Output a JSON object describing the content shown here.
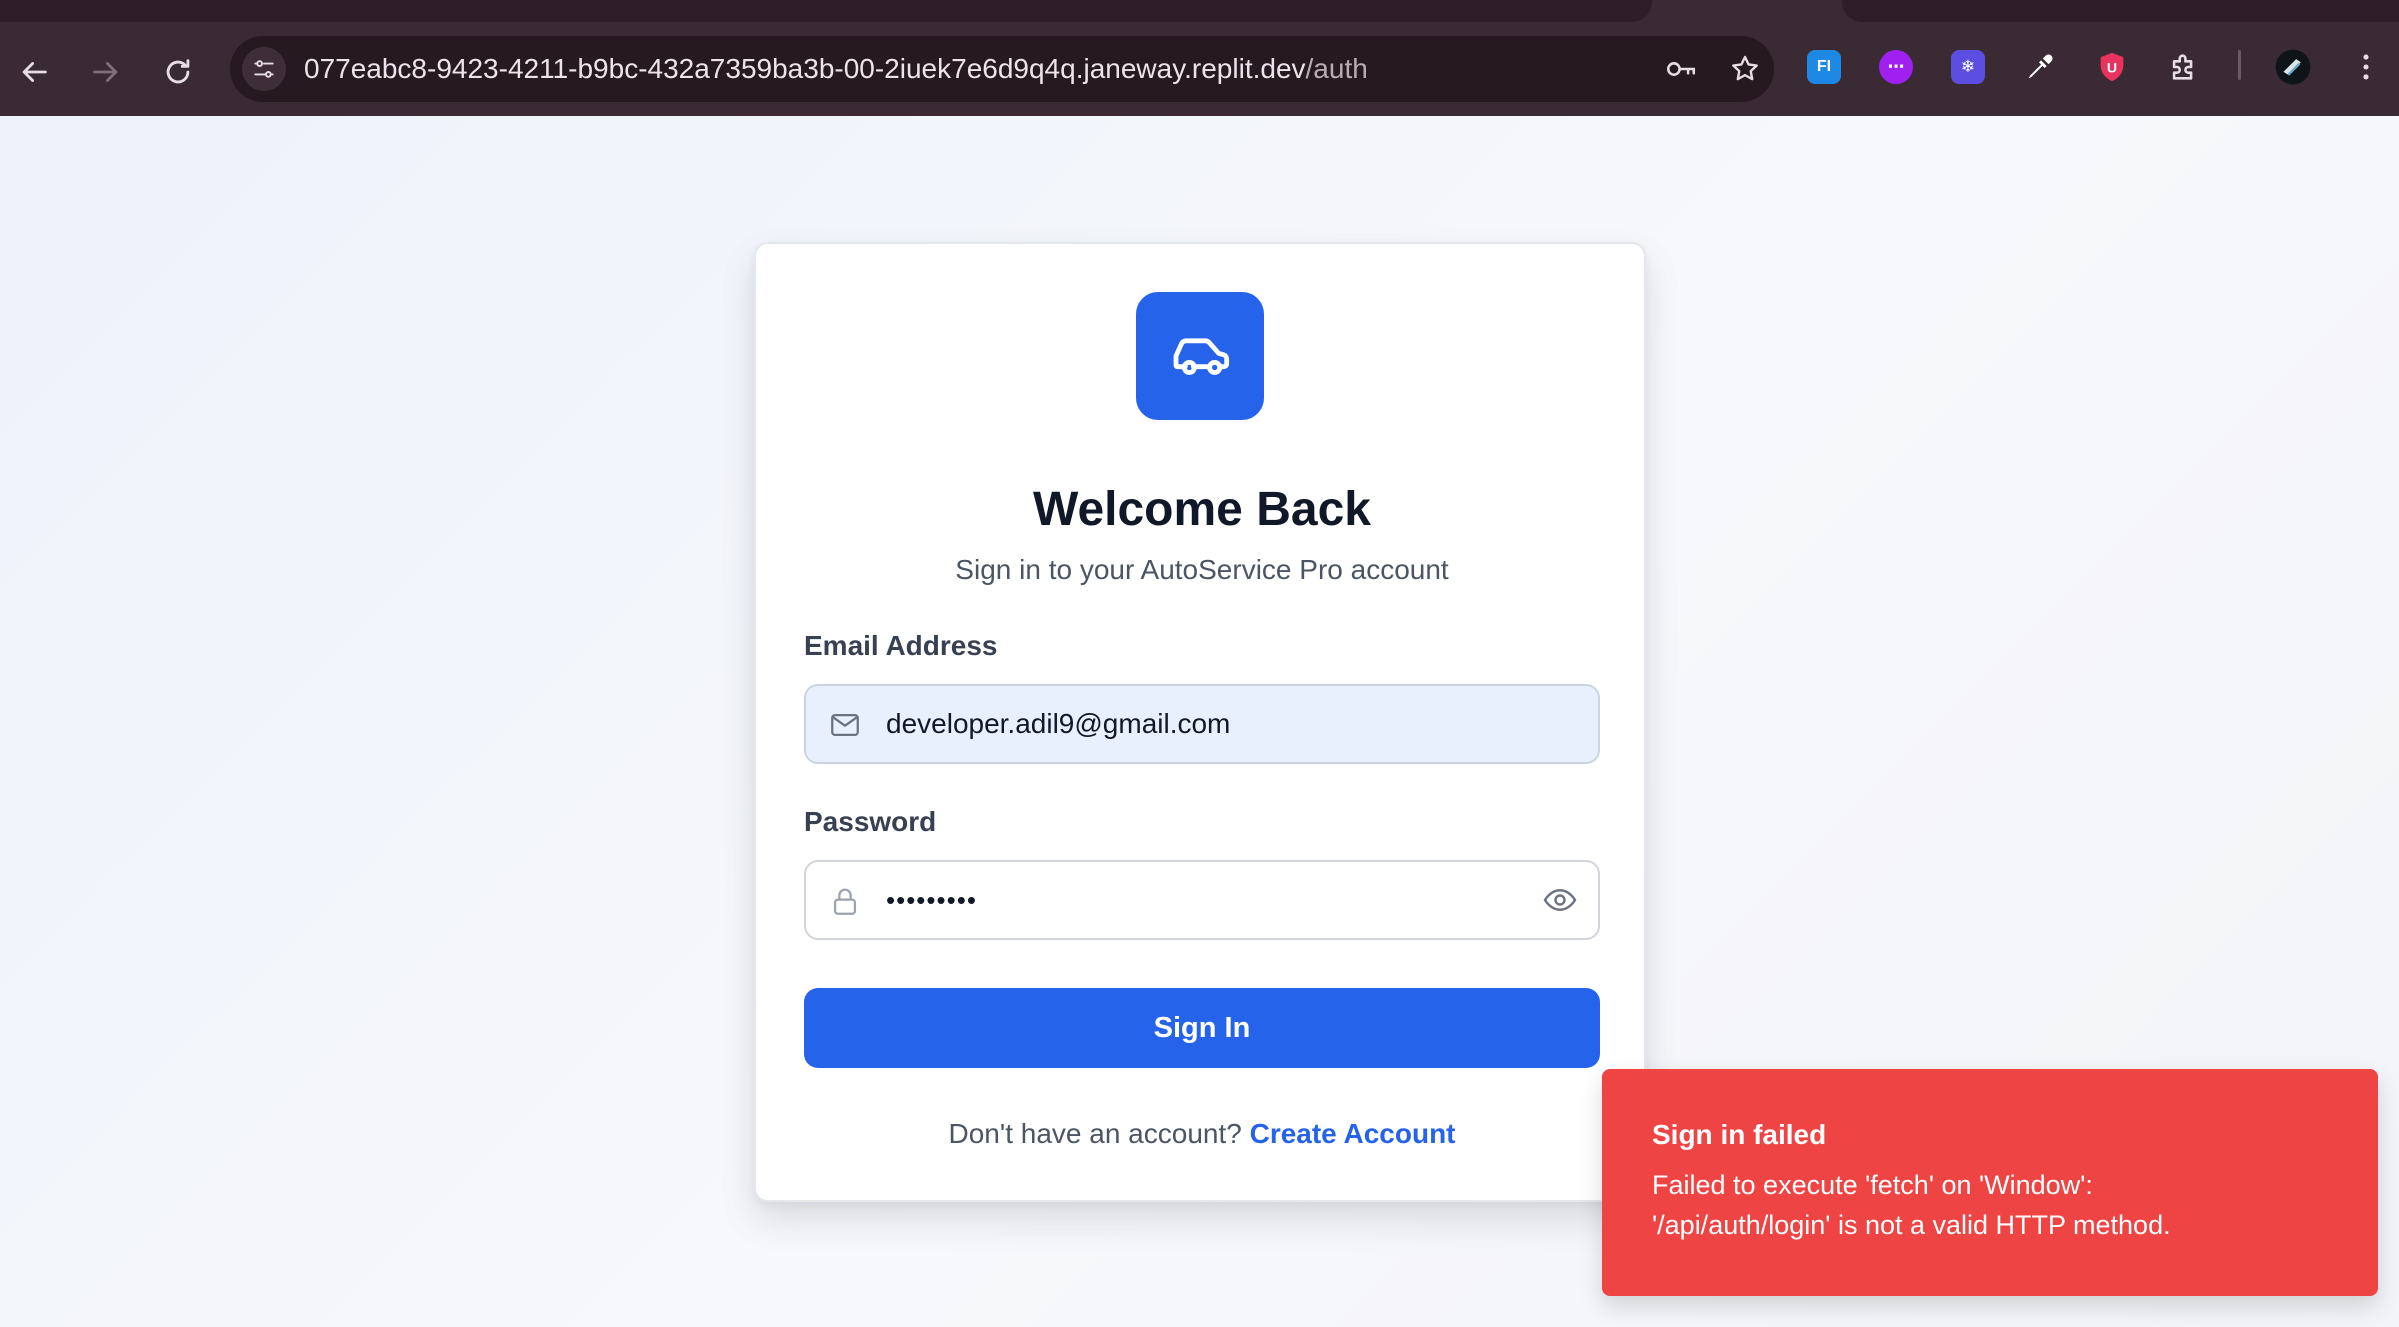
{
  "browser": {
    "url_host": "077eabc8-9423-4211-b9bc-432a7359ba3b-00-2iuek7e6d9q4q.janeway.replit.dev",
    "url_path": "/auth",
    "extensions": [
      {
        "name": "fi-extension-icon",
        "label": "FI",
        "color": "#1e88e5"
      },
      {
        "name": "purple-code-extension-icon",
        "label": "⋯",
        "color": "#a020f0"
      },
      {
        "name": "snowflake-extension-icon",
        "label": "❄",
        "color": "#5b4ee0"
      },
      {
        "name": "eyedropper-extension-icon",
        "label": "",
        "color": "#ffffff"
      },
      {
        "name": "shield-u-extension-icon",
        "label": "U",
        "color": "#e8335c"
      },
      {
        "name": "puzzle-extensions-icon",
        "label": "",
        "color": "#e7dde4"
      }
    ]
  },
  "card": {
    "title": "Welcome Back",
    "subtitle": "Sign in to your AutoService Pro account",
    "email_label": "Email Address",
    "email_value": "developer.adil9@gmail.com",
    "password_label": "Password",
    "password_value": "•••••••••",
    "signin_label": "Sign In",
    "footer_text": "Don't have an account? ",
    "footer_link": "Create Account"
  },
  "toast": {
    "title": "Sign in failed",
    "line1": "Failed to execute 'fetch' on 'Window':",
    "line2": "'/api/auth/login' is not a valid HTTP method."
  },
  "colors": {
    "primary": "#2563eb",
    "error": "#ef4444",
    "chrome": "#3a2a33"
  }
}
